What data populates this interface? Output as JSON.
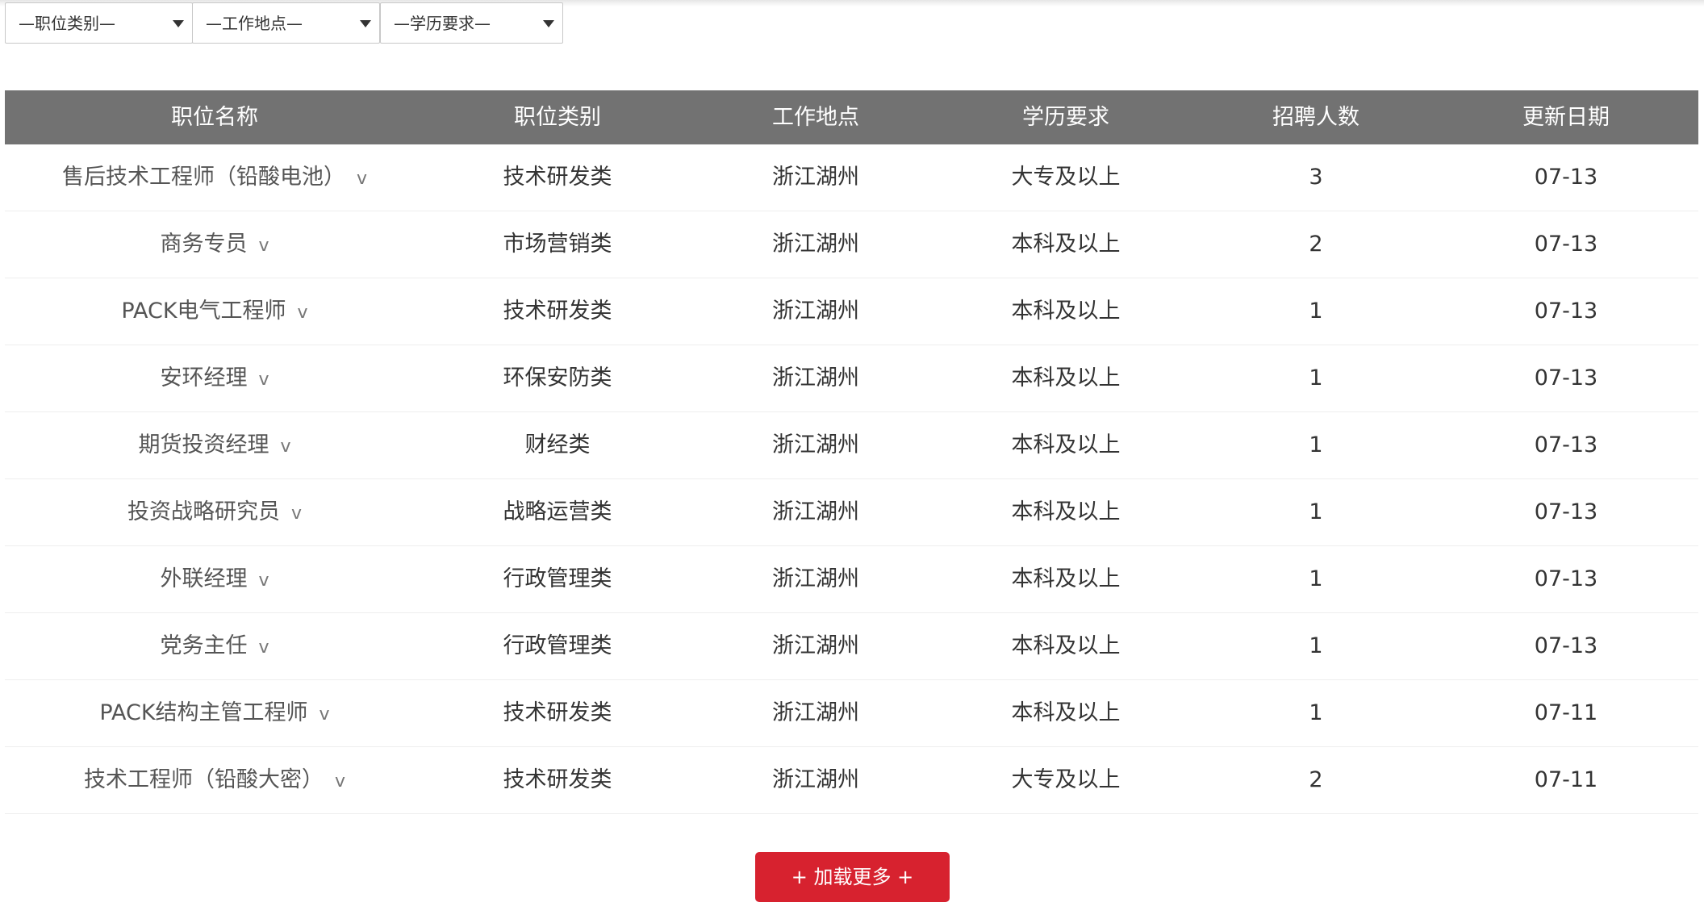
{
  "filters": [
    {
      "label": "—职位类别—"
    },
    {
      "label": "—工作地点—"
    },
    {
      "label": "—学历要求—"
    }
  ],
  "table": {
    "headers": [
      "职位名称",
      "职位类别",
      "工作地点",
      "学历要求",
      "招聘人数",
      "更新日期"
    ],
    "expand_glyph": "v",
    "rows": [
      {
        "name": "售后技术工程师（铅酸电池）",
        "category": "技术研发类",
        "location": "浙江湖州",
        "education": "大专及以上",
        "count": "3",
        "date": "07-13"
      },
      {
        "name": "商务专员",
        "category": "市场营销类",
        "location": "浙江湖州",
        "education": "本科及以上",
        "count": "2",
        "date": "07-13"
      },
      {
        "name": "PACK电气工程师",
        "category": "技术研发类",
        "location": "浙江湖州",
        "education": "本科及以上",
        "count": "1",
        "date": "07-13"
      },
      {
        "name": "安环经理",
        "category": "环保安防类",
        "location": "浙江湖州",
        "education": "本科及以上",
        "count": "1",
        "date": "07-13"
      },
      {
        "name": "期货投资经理",
        "category": "财经类",
        "location": "浙江湖州",
        "education": "本科及以上",
        "count": "1",
        "date": "07-13"
      },
      {
        "name": "投资战略研究员",
        "category": "战略运营类",
        "location": "浙江湖州",
        "education": "本科及以上",
        "count": "1",
        "date": "07-13"
      },
      {
        "name": "外联经理",
        "category": "行政管理类",
        "location": "浙江湖州",
        "education": "本科及以上",
        "count": "1",
        "date": "07-13"
      },
      {
        "name": "党务主任",
        "category": "行政管理类",
        "location": "浙江湖州",
        "education": "本科及以上",
        "count": "1",
        "date": "07-13"
      },
      {
        "name": "PACK结构主管工程师",
        "category": "技术研发类",
        "location": "浙江湖州",
        "education": "本科及以上",
        "count": "1",
        "date": "07-11"
      },
      {
        "name": "技术工程师（铅酸大密）",
        "category": "技术研发类",
        "location": "浙江湖州",
        "education": "大专及以上",
        "count": "2",
        "date": "07-11"
      }
    ]
  },
  "load_more": {
    "label": "+ 加载更多 +"
  },
  "colors": {
    "header_bg": "#727272",
    "accent": "#d7222f"
  }
}
